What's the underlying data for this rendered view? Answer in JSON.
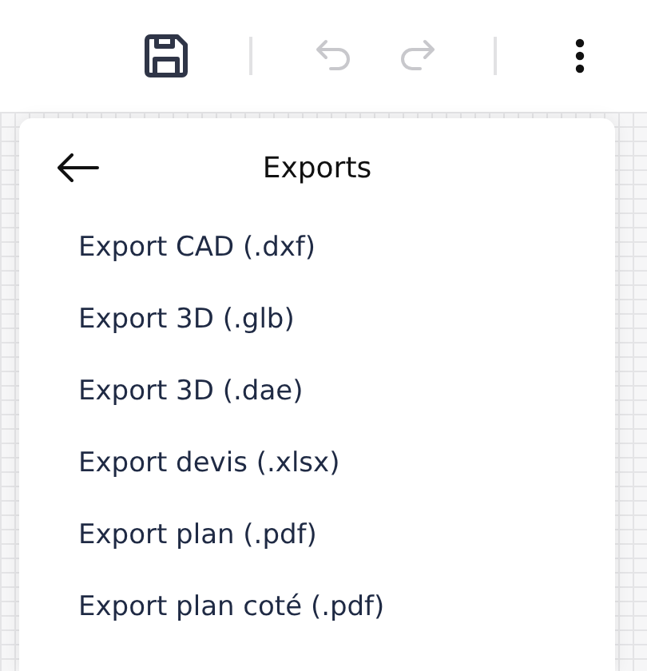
{
  "toolbar": {
    "buttons": [
      {
        "kind": "save",
        "disabled": false
      },
      {
        "kind": "divider"
      },
      {
        "kind": "undo",
        "disabled": true
      },
      {
        "kind": "redo",
        "disabled": true
      },
      {
        "kind": "divider"
      },
      {
        "kind": "more",
        "disabled": false
      }
    ]
  },
  "menu": {
    "title": "Exports",
    "items": [
      {
        "label": "Export CAD (.dxf)"
      },
      {
        "label": "Export 3D (.glb)"
      },
      {
        "label": "Export 3D (.dae)"
      },
      {
        "label": "Export devis (.xlsx)"
      },
      {
        "label": "Export plan (.pdf)"
      },
      {
        "label": "Export plan coté (.pdf)"
      }
    ]
  }
}
